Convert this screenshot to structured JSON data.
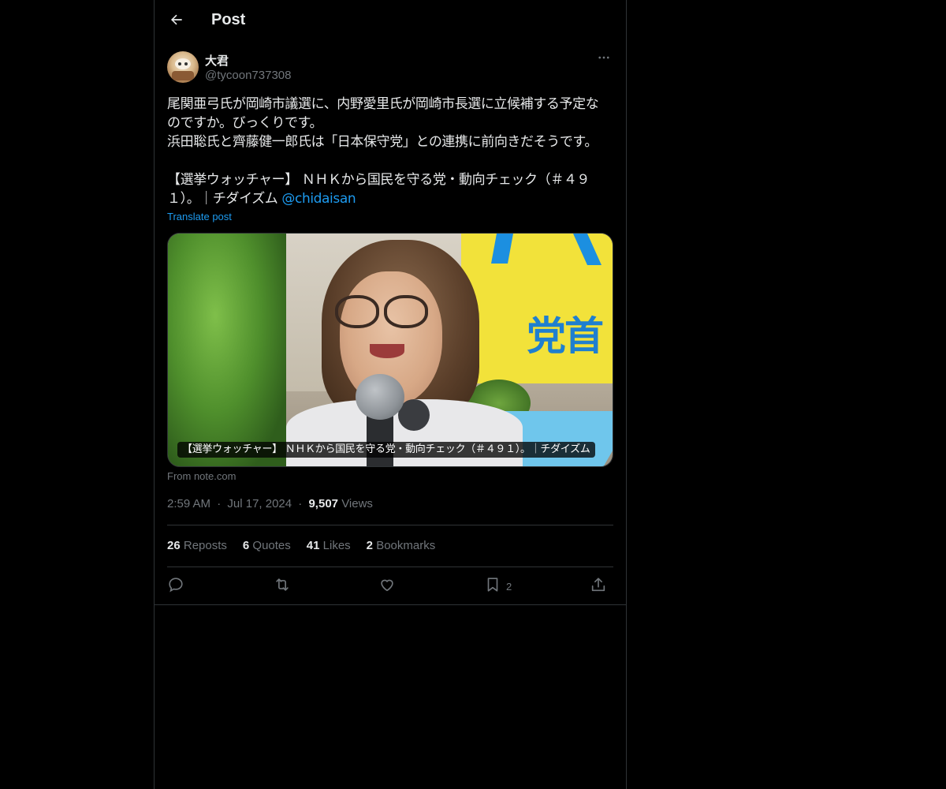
{
  "header": {
    "title": "Post",
    "back_icon": "arrow-left-icon"
  },
  "author": {
    "display_name": "大君",
    "handle": "@tycoon737308",
    "more_icon": "more-horizontal-icon"
  },
  "tweet": {
    "text_lines": [
      "尾関亜弓氏が岡崎市議選に、内野愛里氏が岡崎市長選に立候補する予定な",
      "のですか。びっくりです。",
      "浜田聡氏と齊藤健一郎氏は「日本保守党」との連携に前向きだそうです。",
      "",
      "【選挙ウォッチャー】 ＮＨＫから国民を守る党・動向チェック（＃４９",
      "１）。｜チダイズム "
    ],
    "mention": "@chidaisan",
    "translate_label": "Translate post"
  },
  "card": {
    "caption": "【選挙ウォッチャー】 ＮＨＫから国民を守る党・動向チェック（＃４９１）。｜チダイズム",
    "sign_text": "党首",
    "source": "From note.com"
  },
  "meta": {
    "time": "2:59 AM",
    "separator": "·",
    "date": "Jul 17, 2024",
    "views_count": "9,507",
    "views_label": "Views"
  },
  "stats": [
    {
      "count": "26",
      "label": "Reposts"
    },
    {
      "count": "6",
      "label": "Quotes"
    },
    {
      "count": "41",
      "label": "Likes"
    },
    {
      "count": "2",
      "label": "Bookmarks"
    }
  ],
  "actions": {
    "reply_icon": "reply-icon",
    "repost_icon": "repost-icon",
    "like_icon": "heart-icon",
    "bookmark_icon": "bookmark-icon",
    "bookmark_count": "2",
    "share_icon": "share-icon"
  },
  "colors": {
    "background": "#000000",
    "text": "#e7e9ea",
    "muted": "#71767b",
    "accent": "#1d9bf0",
    "border": "#2f3336"
  }
}
